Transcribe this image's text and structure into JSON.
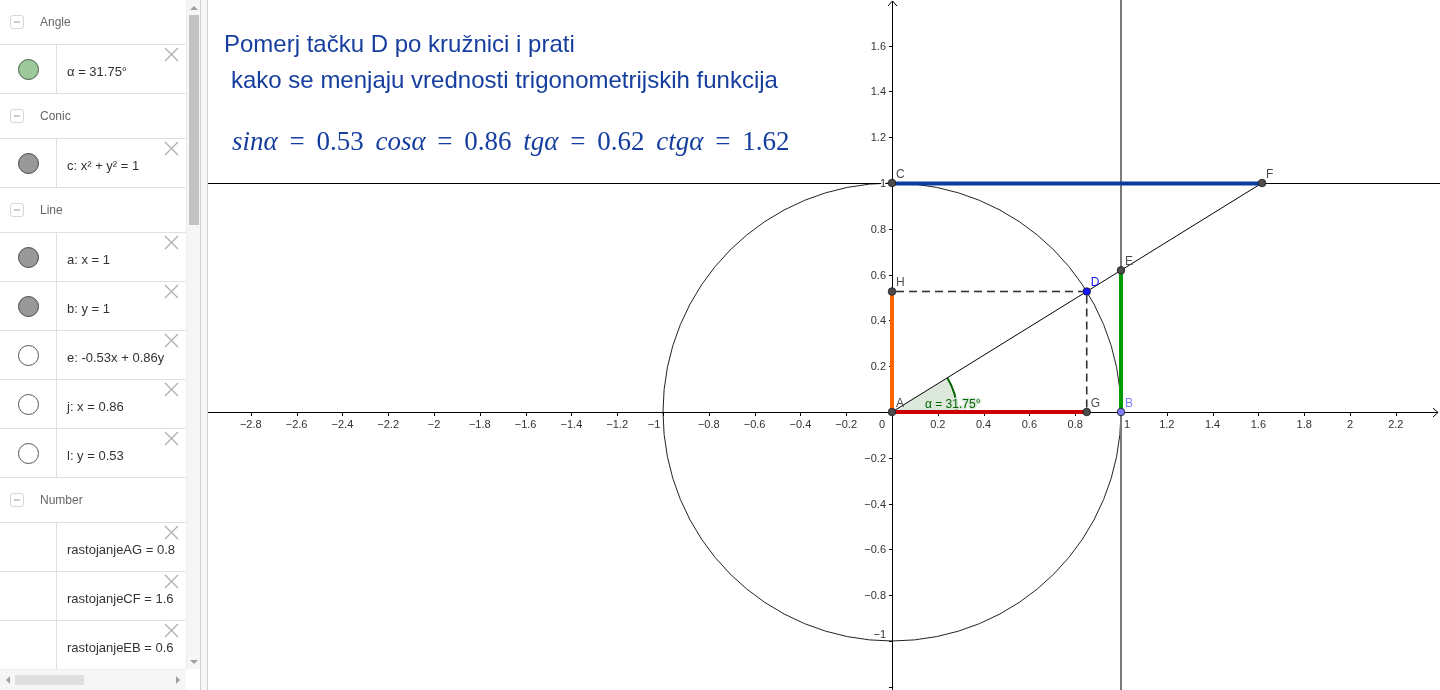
{
  "algebra_view": {
    "groups": [
      {
        "label": "Angle",
        "expanded": true,
        "items": [
          {
            "kind": "object",
            "text": "α = 31.75°",
            "shown": true,
            "color": "#9cc89c"
          }
        ]
      },
      {
        "label": "Conic",
        "expanded": true,
        "items": [
          {
            "kind": "object",
            "text": "c: x² + y² = 1",
            "shown": true,
            "color": "#999999"
          }
        ]
      },
      {
        "label": "Line",
        "expanded": true,
        "items": [
          {
            "kind": "object",
            "text": "a: x = 1",
            "shown": true,
            "color": "#999999"
          },
          {
            "kind": "object",
            "text": "b: y = 1",
            "shown": true,
            "color": "#999999"
          },
          {
            "kind": "object",
            "text": "e: -0.53x + 0.86y",
            "shown": false
          },
          {
            "kind": "object",
            "text": "j: x = 0.86",
            "shown": false
          },
          {
            "kind": "object",
            "text": "l: y = 0.53",
            "shown": false
          }
        ]
      },
      {
        "label": "Number",
        "expanded": true,
        "items": [
          {
            "kind": "number",
            "text": "rastojanjeAG = 0.8"
          },
          {
            "kind": "number",
            "text": "rastojanjeCF = 1.6"
          },
          {
            "kind": "number",
            "text": "rastojanjeEB = 0.6"
          }
        ]
      }
    ]
  },
  "graphics_view": {
    "instruction_lines": [
      "Pomerj tačku D po kružnici i prati",
      "kako se menjaju vrednosti trigonometrijskih funkcija"
    ],
    "formula": "*sinα* = 0.53 *cosα* = 0.86 *tgα* = 0.62 *ctgα* = 1.62",
    "x_axis_labels": [
      "−2.8",
      "−2.6",
      "−2.4",
      "−2.2",
      "−2",
      "−1.8",
      "−1.6",
      "−1.4",
      "−1.2",
      "−1",
      "−0.8",
      "−0.6",
      "−0.4",
      "−0.2",
      "0",
      "0.2",
      "0.4",
      "0.6",
      "0.8",
      "1",
      "1.2",
      "1.4",
      "1.6",
      "1.8",
      "2",
      "2.2"
    ],
    "y_axis_labels": [
      "1.6",
      "1.4",
      "1.2",
      "1",
      "0.8",
      "0.6",
      "0.4",
      "0.2",
      "−0.2",
      "−0.4",
      "−0.6",
      "−0.8",
      "−1"
    ],
    "points": [
      {
        "label": "A",
        "color": "#4d4d4d"
      },
      {
        "label": "B",
        "color": "#7d7dff"
      },
      {
        "label": "C",
        "color": "#4d4d4d"
      },
      {
        "label": "D",
        "color": "#1414ff"
      },
      {
        "label": "E",
        "color": "#4d4d4d"
      },
      {
        "label": "F",
        "color": "#4d4d4d"
      },
      {
        "label": "G",
        "color": "#4d4d4d"
      },
      {
        "label": "H",
        "color": "#4d4d4d"
      }
    ],
    "angle_label": "α = 31.75°"
  }
}
